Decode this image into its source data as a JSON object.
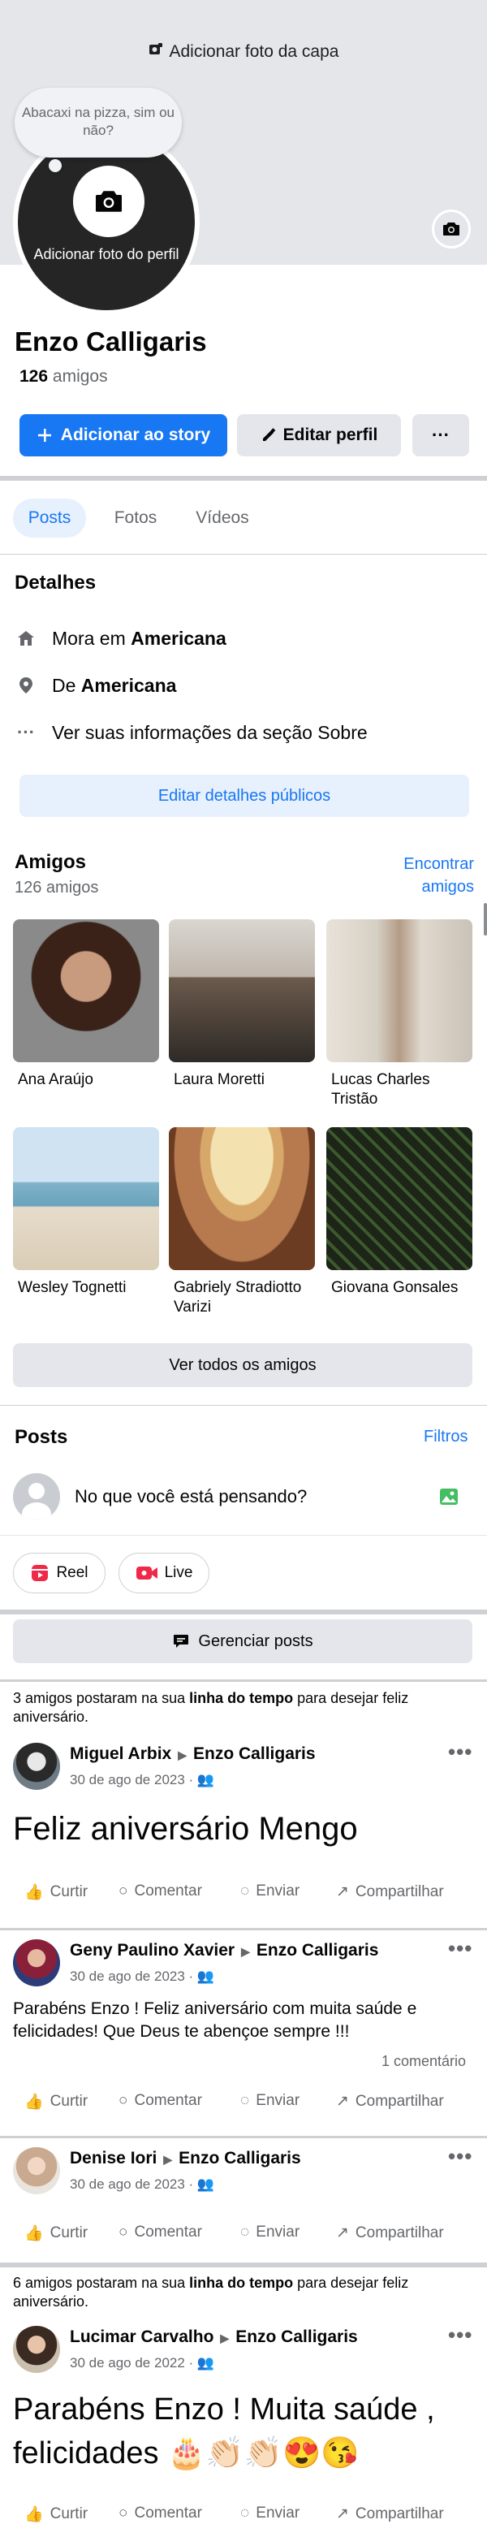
{
  "cover": {
    "add_cover_label": "Adicionar foto da capa"
  },
  "profile": {
    "bubble_text": "Abacaxi na pizza, sim ou não?",
    "add_photo_label": "Adicionar foto do perfil",
    "name": "Enzo Calligaris",
    "friends_number": "126",
    "friends_word": "amigos"
  },
  "actions": {
    "add_story": "Adicionar ao story",
    "edit_profile": "Editar perfil",
    "more": "···"
  },
  "tabs": [
    {
      "label": "Posts"
    },
    {
      "label": "Fotos"
    },
    {
      "label": "Vídeos"
    }
  ],
  "details": {
    "title": "Detalhes",
    "lives_prefix": "Mora em",
    "lives_city": "Americana",
    "from_prefix": "De",
    "from_city": "Americana",
    "about": "Ver suas informações da seção Sobre",
    "edit_public": "Editar detalhes públicos"
  },
  "friends": {
    "title": "Amigos",
    "count": "126 amigos",
    "find_line1": "Encontrar",
    "find_line2": "amigos",
    "list": [
      {
        "name": "Ana Araújo"
      },
      {
        "name": "Laura Moretti"
      },
      {
        "name": "Lucas Charles Tristão"
      },
      {
        "name": "Wesley Tognetti"
      },
      {
        "name": "Gabriely Stradiotto Varizi"
      },
      {
        "name": "Giovana Gonsales"
      }
    ],
    "see_all": "Ver todos os amigos"
  },
  "posts_section": {
    "title": "Posts",
    "filters": "Filtros",
    "composer_placeholder": "No que você está pensando?",
    "reel": "Reel",
    "live": "Live",
    "manage": "Gerenciar posts"
  },
  "timeline_note_1": {
    "pre": "3 amigos postaram na sua ",
    "bold": "linha do tempo",
    "post": " para desejar feliz aniversário."
  },
  "timeline_note_2": {
    "pre": "6 amigos postaram na sua ",
    "bold": "linha do tempo",
    "post": " para desejar feliz aniversário."
  },
  "post_actions": {
    "like": "Curtir",
    "comment": "Comentar",
    "send": "Enviar",
    "share": "Compartilhar"
  },
  "posts": [
    {
      "author": "Miguel Arbix",
      "target": "Enzo Calligaris",
      "date": "30 de ago de 2023",
      "text": "Feliz aniversário Mengo"
    },
    {
      "author": "Geny Paulino Xavier",
      "target": "Enzo Calligaris",
      "date": "30 de ago de 2023",
      "text": "Parabéns Enzo ! Feliz aniversário com muita saúde e felicidades! Que Deus te abençoe sempre !!!",
      "comments": "1 comentário"
    },
    {
      "author": "Denise Iori",
      "target": "Enzo Calligaris",
      "date": "30 de ago de 2023"
    },
    {
      "author": "Lucimar Carvalho",
      "target": "Enzo Calligaris",
      "date": "30 de ago de 2022",
      "text_line1": "Parabéns Enzo ! Muita saúde ,",
      "text_line2": "felicidades 🎂👏🏻👏🏻😍😘"
    }
  ]
}
